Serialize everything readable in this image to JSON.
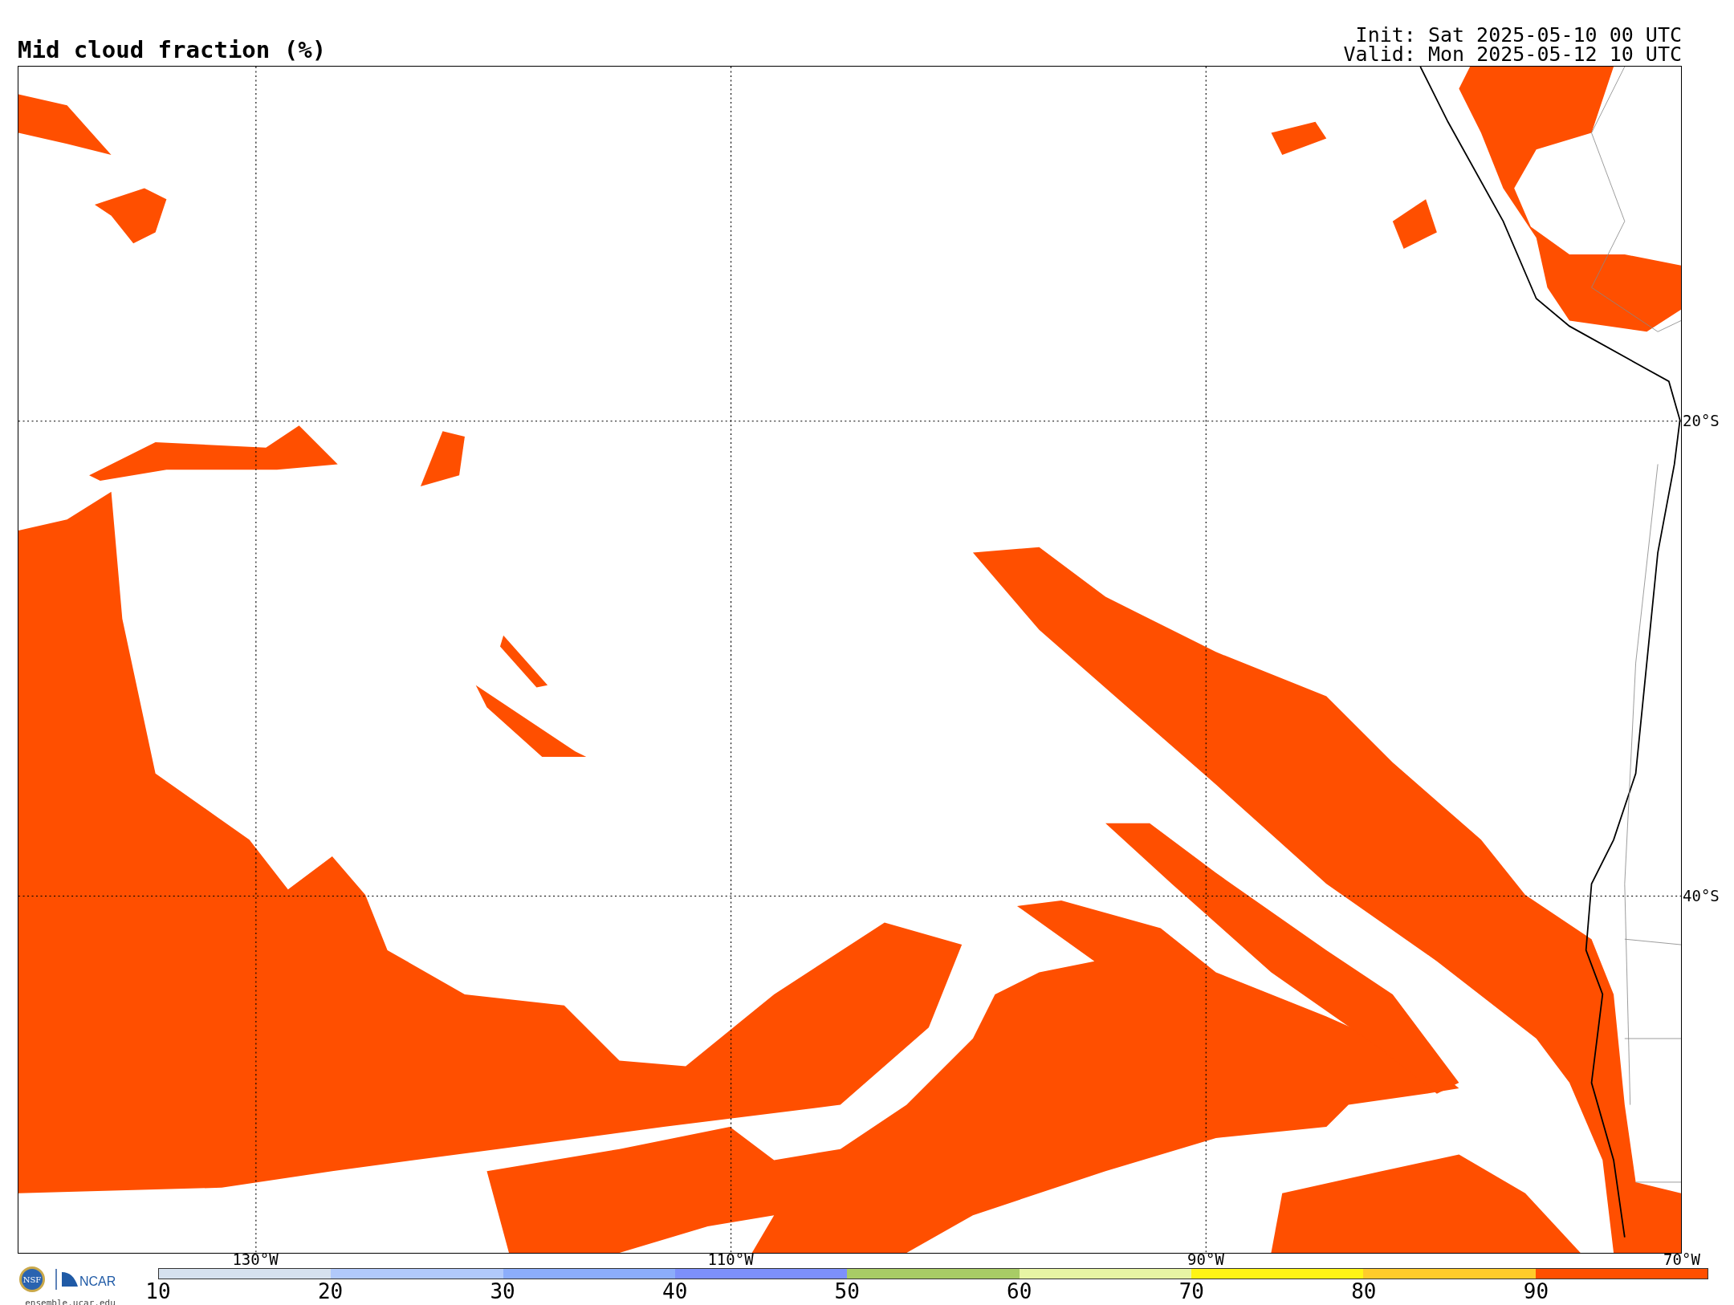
{
  "title": "Mid cloud fraction (%)",
  "init": "Init: Sat 2025-05-10 00 UTC",
  "valid": "Valid: Mon 2025-05-12 10 UTC",
  "map": {
    "lat_labels": [
      "20°S",
      "40°S"
    ],
    "lon_labels": [
      "130°W",
      "110°W",
      "90°W",
      "70°W"
    ]
  },
  "branding": {
    "nsf": "NSF",
    "ncar": "NCAR",
    "site": "ensemble.ucar.edu"
  },
  "colorbar": {
    "bins": [
      {
        "color": "#d6e1ee"
      },
      {
        "color": "#b1c9fb"
      },
      {
        "color": "#8cadfb"
      },
      {
        "color": "#7d90fb"
      },
      {
        "color": "#a8cc66"
      },
      {
        "color": "#e7f5a4"
      },
      {
        "color": "#fff515"
      },
      {
        "color": "#ffcc2b"
      },
      {
        "color": "#ff4f00"
      }
    ],
    "ticks": [
      "10",
      "20",
      "30",
      "40",
      "50",
      "60",
      "70",
      "80",
      "90"
    ]
  }
}
